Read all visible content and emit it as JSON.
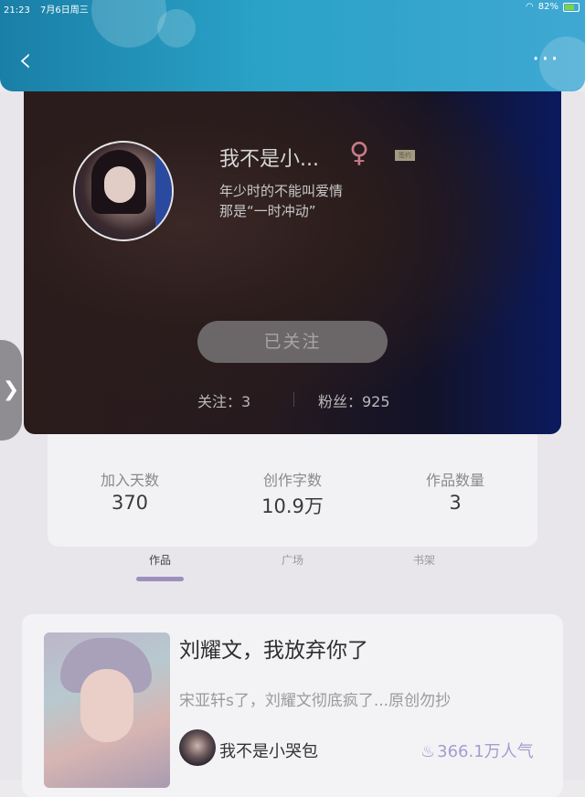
{
  "status_bar": {
    "time": "21:23",
    "date": "7月6日周三",
    "battery": "82%"
  },
  "header": {
    "back_icon": "chevron-left-icon",
    "more_icon": "more-dots-icon"
  },
  "profile": {
    "username": "我不是小...",
    "gender_symbol": "♀",
    "badge": "签约",
    "bio_line1": "年少时的不能叫爱情",
    "bio_line2": "那是“一时冲动”",
    "follow_button": "已关注",
    "following_label": "关注：3",
    "fans_label": "粉丝：925"
  },
  "metrics": [
    {
      "label": "加入天数",
      "value": "370"
    },
    {
      "label": "创作字数",
      "value": "10.9万"
    },
    {
      "label": "作品数量",
      "value": "3"
    }
  ],
  "tabs": [
    {
      "label": "作品",
      "active": true
    },
    {
      "label": "广场",
      "active": false
    },
    {
      "label": "书架",
      "active": false
    }
  ],
  "work": {
    "title": "刘耀文，我放弃你了",
    "description": "宋亚轩s了，刘耀文彻底疯了...原创勿抄",
    "author": "我不是小哭包",
    "popularity": "366.1万人气"
  },
  "side_handle": "❯"
}
